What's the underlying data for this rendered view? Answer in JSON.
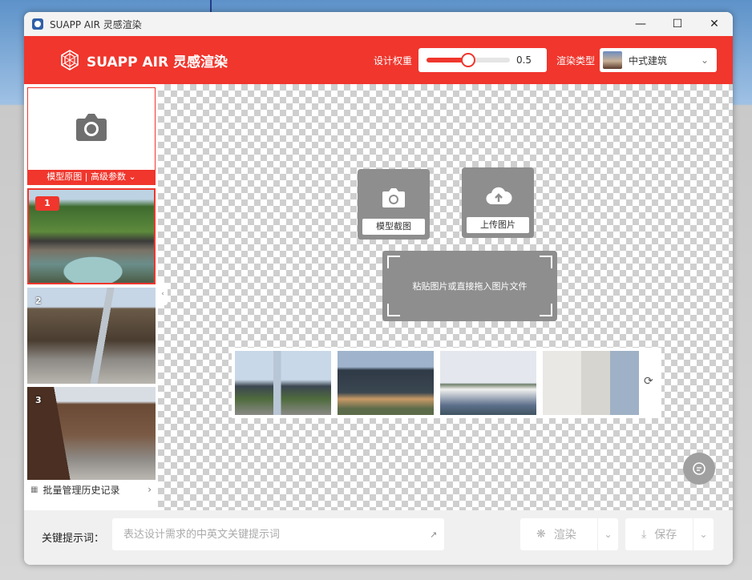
{
  "window": {
    "title": "SUAPP AIR 灵感渲染"
  },
  "header": {
    "brand": "SUAPP AIR 灵感渲染",
    "weight_label": "设计权重",
    "weight_value": "0.5",
    "weight_fraction": 0.5,
    "render_type_label": "渲染类型",
    "render_type_value": "中式建筑",
    "accent_color": "#f0362d"
  },
  "sidebar": {
    "original": {
      "label": "模型原图 | 高级参数"
    },
    "history": [
      {
        "num": "1",
        "selected": true
      },
      {
        "num": "2",
        "selected": false
      },
      {
        "num": "3",
        "selected": false
      }
    ],
    "batch_label": "批量管理历史记录"
  },
  "canvas": {
    "screenshot_label": "模型截图",
    "upload_label": "上传图片",
    "drop_hint": "粘贴图片或直接拖入图片文件"
  },
  "footer": {
    "keyword_label": "关键提示词：",
    "keyword_placeholder": "表达设计需求的中英文关键提示词",
    "keyword_value": "",
    "render_label": "渲染",
    "save_label": "保存"
  },
  "icons": [
    "app-icon",
    "minimize-icon",
    "maximize-icon",
    "close-icon",
    "logo-icon",
    "chevron-down-icon",
    "camera-icon",
    "cloud-upload-icon",
    "grid-icon",
    "chevron-right-icon",
    "refresh-icon",
    "chat-icon",
    "expand-icon",
    "sparkle-icon",
    "download-icon"
  ]
}
